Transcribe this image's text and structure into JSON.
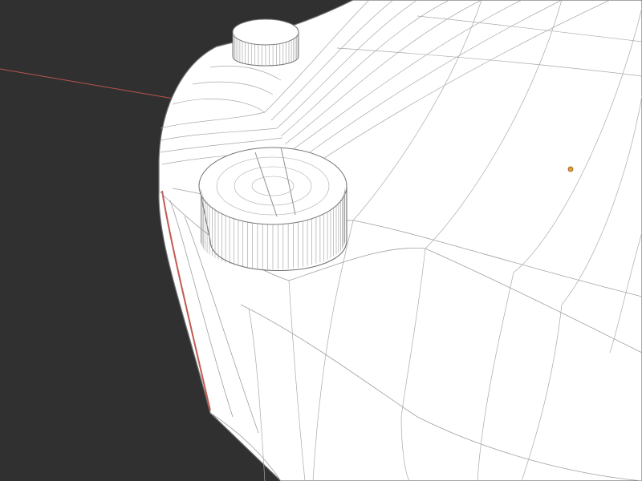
{
  "viewport": {
    "background_color": "#303030",
    "mesh_fill_color": "#ffffff",
    "wire_color": "#9a9a9a",
    "silhouette_color": "#6f6f6f",
    "axis_line_color": "#b8544e",
    "origin_color": "#e39a3a",
    "icons": [
      "wireframe-mesh",
      "screw-head",
      "object-origin",
      "x-axis-line"
    ]
  }
}
